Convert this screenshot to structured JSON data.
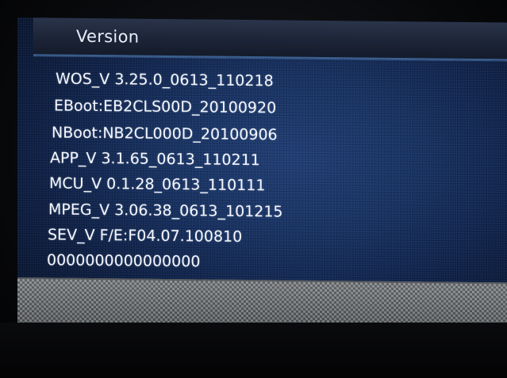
{
  "screen": {
    "title": "Version",
    "lines": [
      "WOS_V 3.25.0_0613_110218",
      "EBoot:EB2CLS00D_20100920",
      "NBoot:NB2CL000D_20100906",
      "APP_V 3.1.65_0613_110211",
      "MCU_V 0.1.28_0613_110111",
      "MPEG_V 3.06.38_0613_101215",
      "SEV_V F/E:F04.07.100810",
      "0000000000000000"
    ]
  },
  "colors": {
    "screen_blue": "#163060",
    "text": "#f4f6fb",
    "title_bar": "#1b2336",
    "footer": "#8a8d90"
  }
}
